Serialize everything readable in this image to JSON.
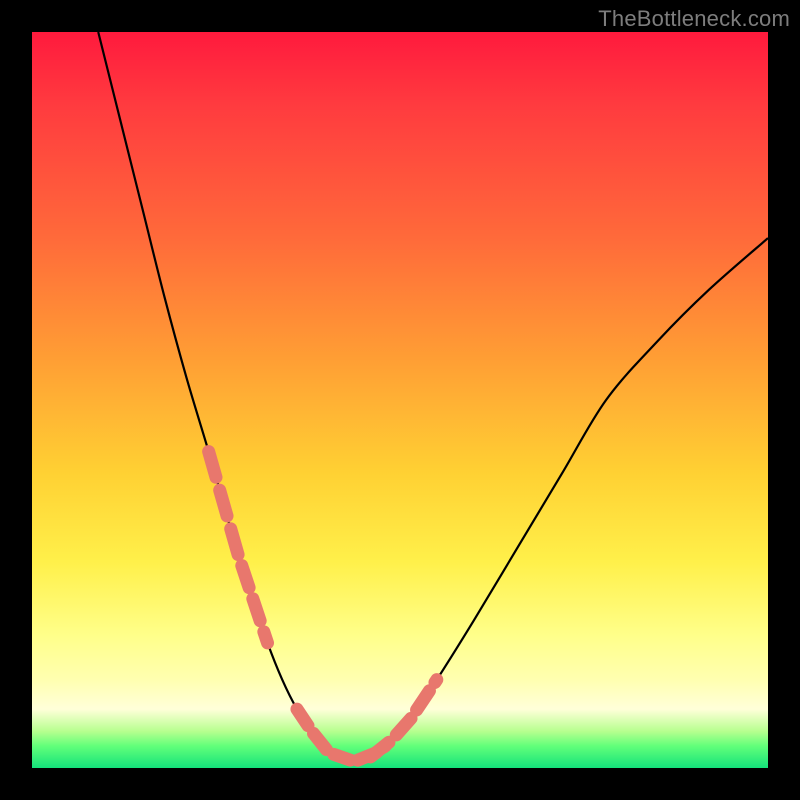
{
  "watermark": "TheBottleneck.com",
  "chart_data": {
    "type": "line",
    "title": "",
    "xlabel": "",
    "ylabel": "",
    "xlim": [
      0,
      100
    ],
    "ylim": [
      0,
      100
    ],
    "series": [
      {
        "name": "bottleneck-curve",
        "x": [
          9,
          12,
          15,
          18,
          21,
          24,
          26,
          28,
          30,
          32,
          34,
          36,
          38,
          40,
          42,
          44,
          46,
          48,
          51,
          55,
          60,
          66,
          72,
          78,
          85,
          92,
          100
        ],
        "y": [
          100,
          88,
          76,
          64,
          53,
          43,
          36,
          29,
          23,
          17,
          12,
          8,
          5,
          2.5,
          1.2,
          1,
          1.5,
          3,
          6,
          12,
          20,
          30,
          40,
          50,
          58,
          65,
          72
        ]
      }
    ],
    "dashed_overlay": {
      "name": "highlight-dashes",
      "segments_left_x": [
        24,
        32
      ],
      "segments_right_x": [
        46,
        55
      ],
      "bottom_x": [
        36,
        48
      ]
    },
    "colors": {
      "curve": "#000000",
      "dash": "#e8776d",
      "gradient_top": "#ff1a3d",
      "gradient_bottom": "#14e27b"
    }
  }
}
